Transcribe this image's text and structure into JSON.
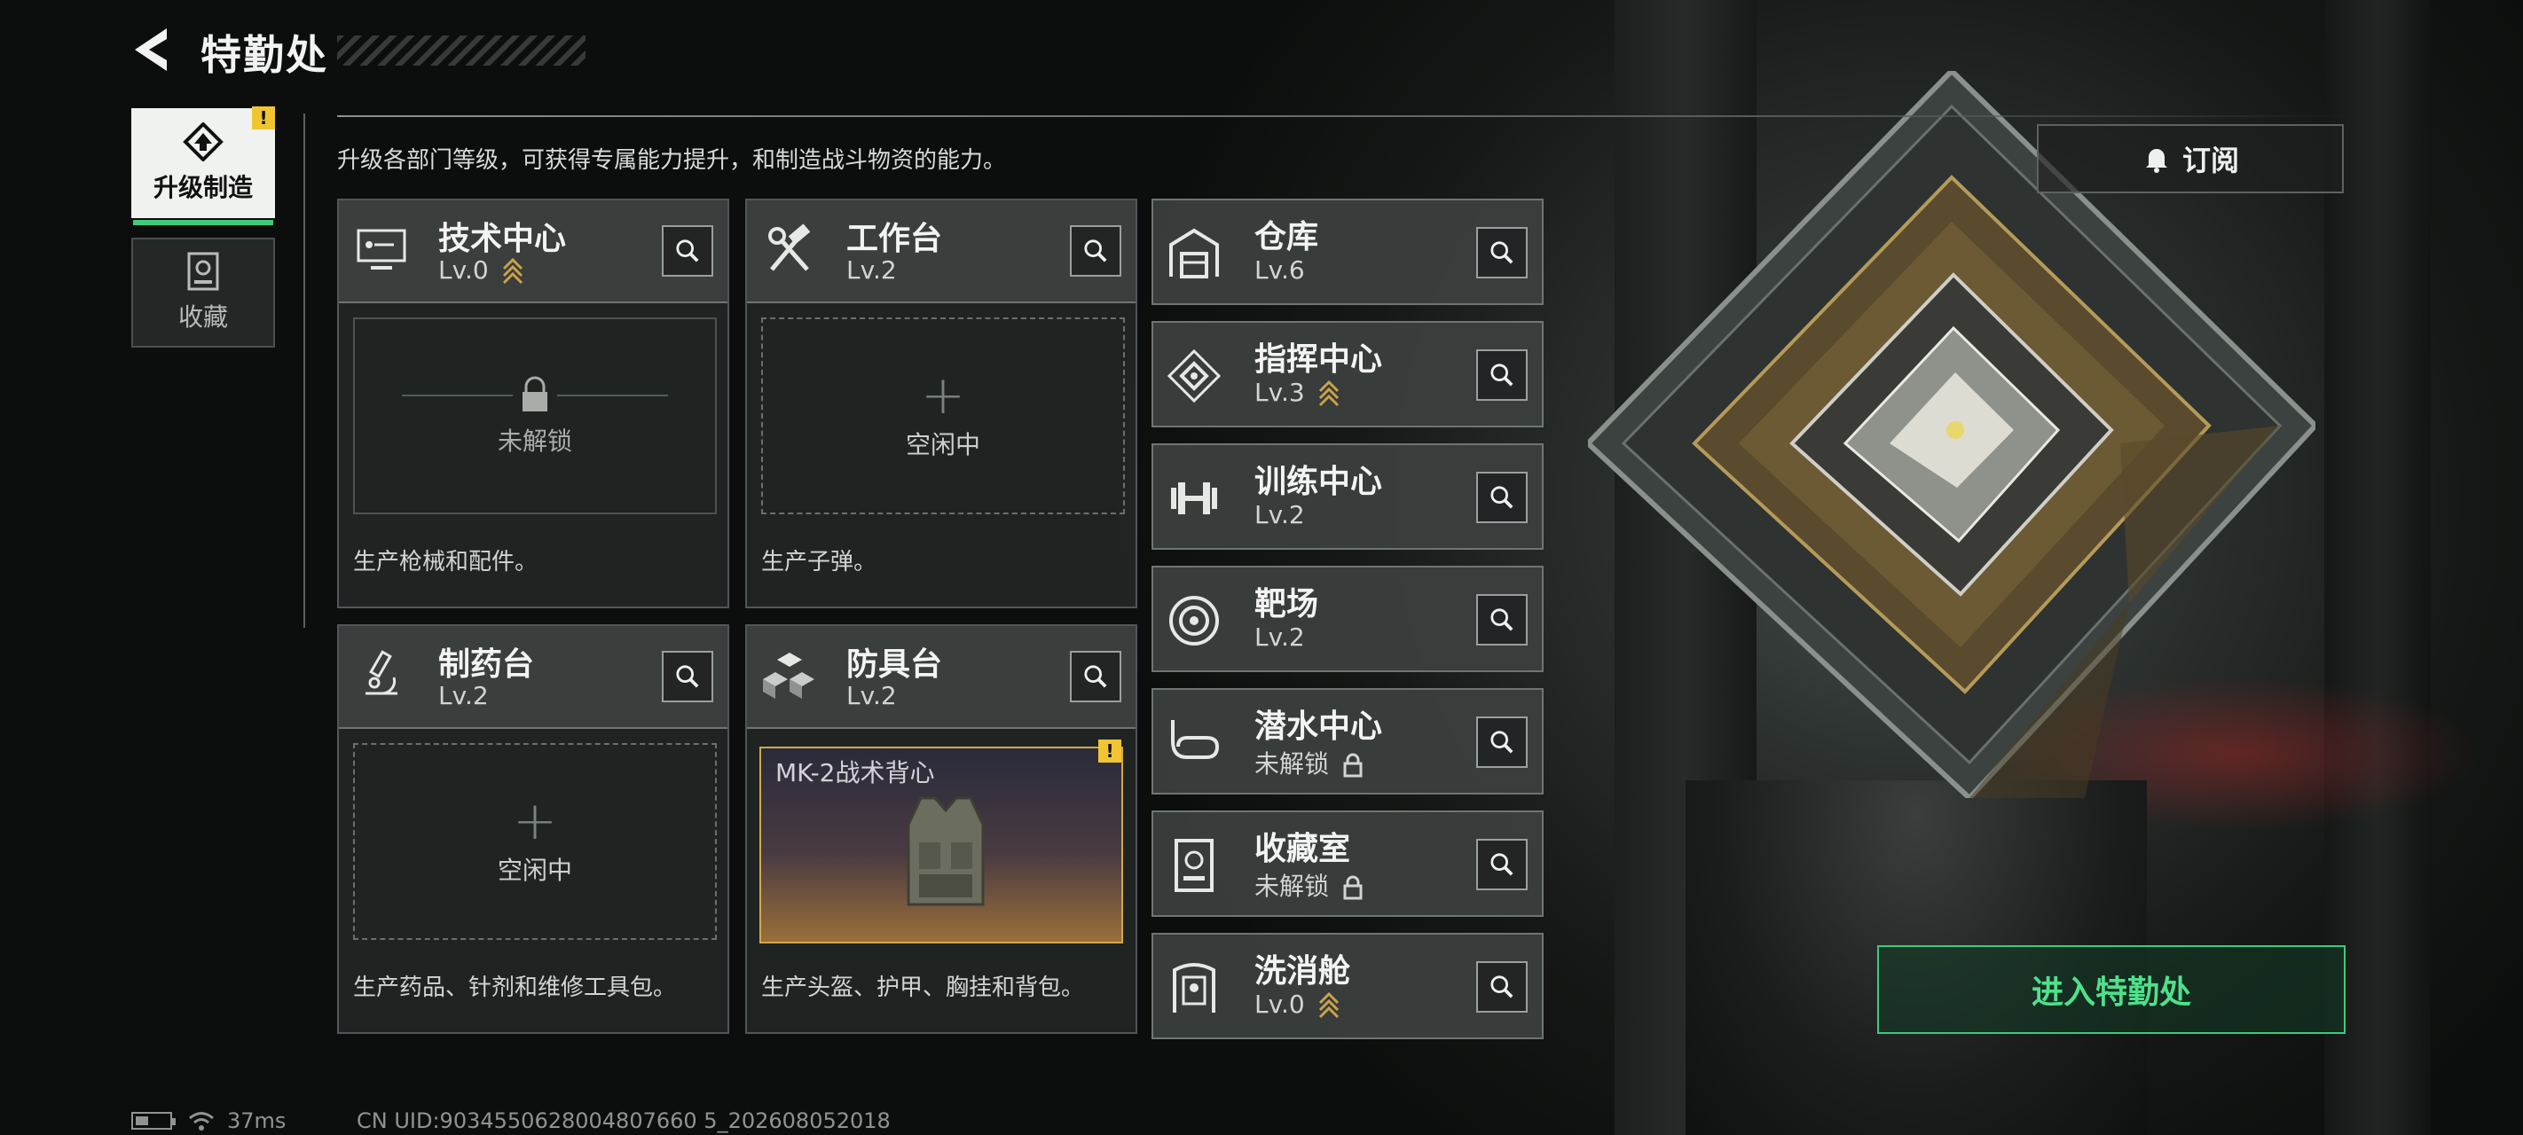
{
  "header": {
    "title": "特勤处"
  },
  "tabs": [
    {
      "label": "升级制造",
      "active": true,
      "alert": "!"
    },
    {
      "label": "收藏",
      "active": false
    }
  ],
  "description": "升级各部门等级，可获得专属能力提升，和制造战斗物资的能力。",
  "subscribe_label": "订阅",
  "enter_label": "进入特勤处",
  "cards": [
    {
      "name": "技术中心",
      "level": "Lv.0",
      "state": "未解锁",
      "footer": "生产枪械和配件。",
      "icon": "computer-icon"
    },
    {
      "name": "工作台",
      "level": "Lv.2",
      "state": "空闲中",
      "footer": "生产子弹。",
      "icon": "hammer-wrench-icon"
    },
    {
      "name": "制药台",
      "level": "Lv.2",
      "state": "空闲中",
      "footer": "生产药品、针剂和维修工具包。",
      "icon": "microscope-icon"
    },
    {
      "name": "防具台",
      "level": "Lv.2",
      "item": "MK-2战术背心",
      "alert": "!",
      "footer": "生产头盔、护甲、胸挂和背包。",
      "icon": "cubes-icon"
    }
  ],
  "buildings": [
    {
      "name": "仓库",
      "level": "Lv.6",
      "icon": "warehouse-icon"
    },
    {
      "name": "指挥中心",
      "level": "Lv.3",
      "icon": "command-diamond-icon"
    },
    {
      "name": "训练中心",
      "level": "Lv.2",
      "icon": "dumbbell-icon"
    },
    {
      "name": "靶场",
      "level": "Lv.2",
      "icon": "target-icon"
    },
    {
      "name": "潜水中心",
      "level": "未解锁",
      "icon": "diving-mask-icon"
    },
    {
      "name": "收藏室",
      "level": "未解锁",
      "icon": "trophy-case-icon"
    },
    {
      "name": "洗消舱",
      "level": "Lv.0",
      "icon": "decon-chamber-icon"
    }
  ],
  "status": {
    "ping": "37ms",
    "uid": "CN UID:9034550628004807660 5_202608052018"
  },
  "colors": {
    "accent": "#3ecb79",
    "warning": "#f0c531",
    "upgrade": "#c9a24a"
  }
}
